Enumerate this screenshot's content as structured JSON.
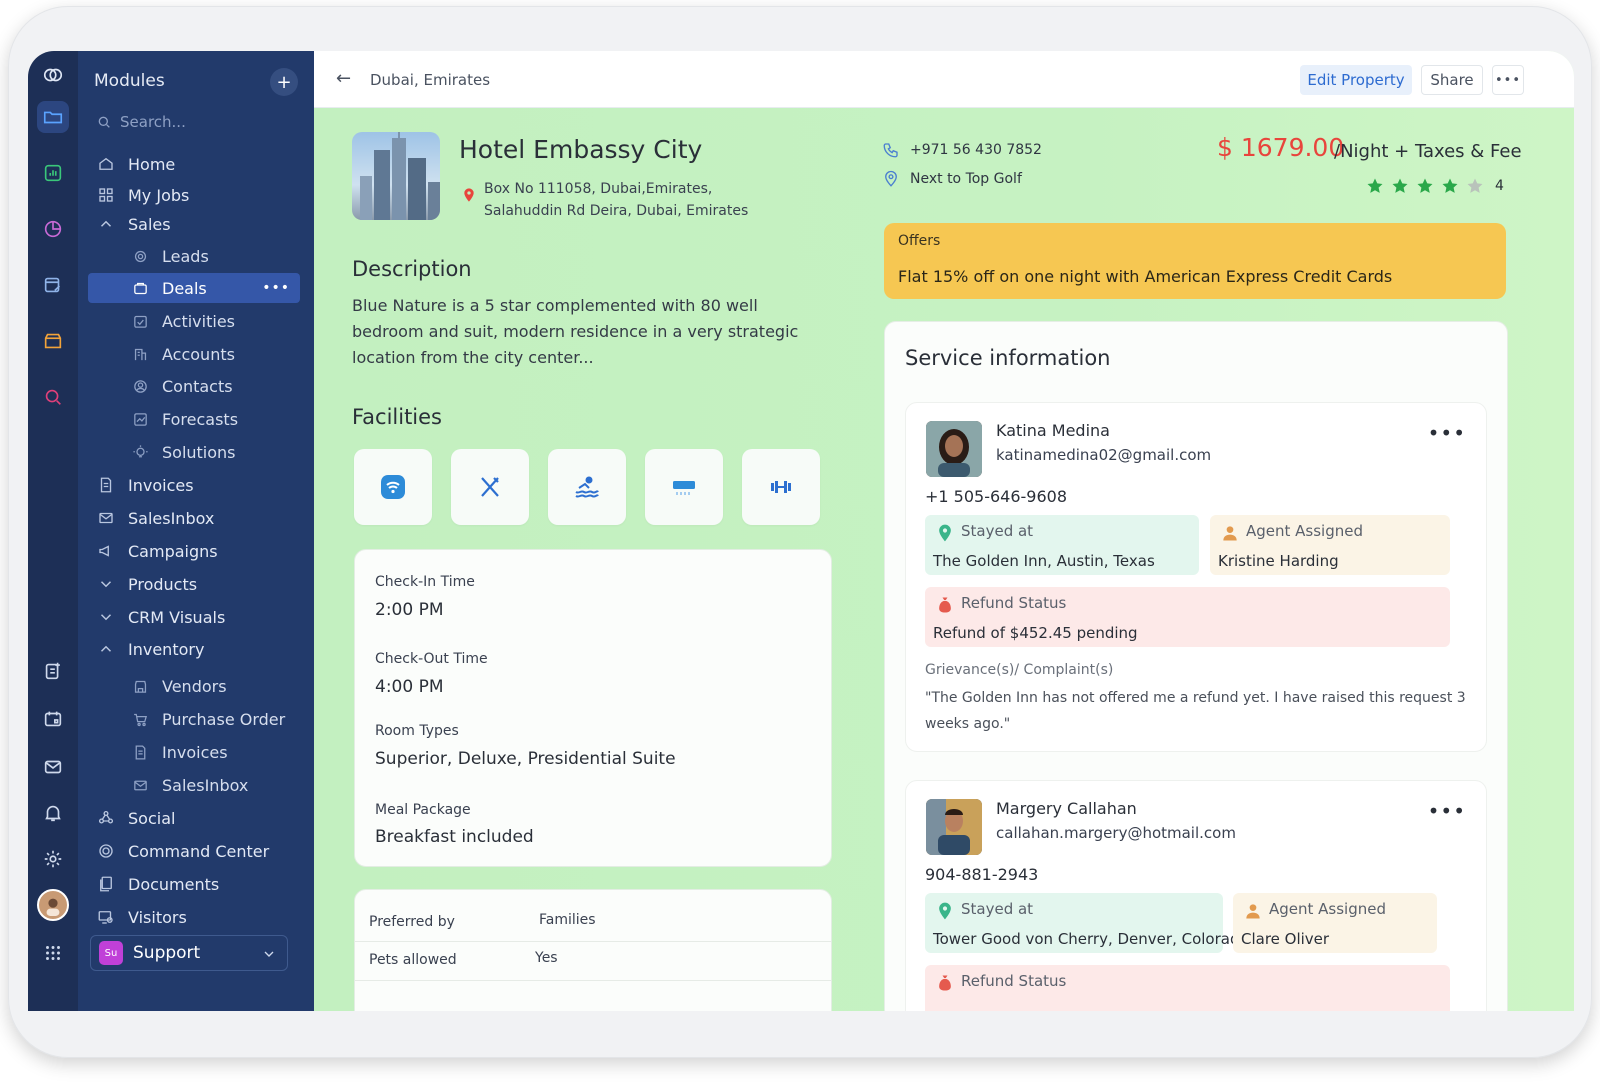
{
  "sidebar": {
    "title": "Modules",
    "search_placeholder": "Search...",
    "items": [
      {
        "label": "Home"
      },
      {
        "label": "My Jobs"
      },
      {
        "label": "Sales"
      },
      {
        "label": "Leads"
      },
      {
        "label": "Deals"
      },
      {
        "label": "Activities"
      },
      {
        "label": "Accounts"
      },
      {
        "label": "Contacts"
      },
      {
        "label": "Forecasts"
      },
      {
        "label": "Solutions"
      },
      {
        "label": "Invoices"
      },
      {
        "label": "SalesInbox"
      },
      {
        "label": "Campaigns"
      },
      {
        "label": "Products"
      },
      {
        "label": "CRM Visuals"
      },
      {
        "label": "Inventory"
      },
      {
        "label": "Vendors"
      },
      {
        "label": "Purchase Order"
      },
      {
        "label": "Invoices"
      },
      {
        "label": "SalesInbox"
      },
      {
        "label": "Social"
      },
      {
        "label": "Command Center"
      },
      {
        "label": "Documents"
      },
      {
        "label": "Visitors"
      }
    ],
    "support": {
      "badge": "Su",
      "label": "Support"
    }
  },
  "topbar": {
    "breadcrumb": "Dubai, Emirates",
    "edit_label": "Edit Property",
    "share_label": "Share"
  },
  "hotel": {
    "name": "Hotel Embassy City",
    "address_line1": "Box No 111058, Dubai,Emirates,",
    "address_line2": "Salahuddin Rd Deira, Dubai, Emirates",
    "phone": "+971 56 430 7852",
    "landmark": "Next to Top Golf",
    "price": "$ 1679.00",
    "price_suffix": "/Night + Taxes & Fee",
    "rating": "4",
    "rating_value": 4,
    "rating_max": 5
  },
  "description": {
    "heading": "Description",
    "text": "Blue Nature is a 5 star complemented with 80 well bedroom and suit, modern residence in a very strategic location from the city center..."
  },
  "facilities": {
    "heading": "Facilities",
    "icons": [
      "wifi-icon",
      "restaurant-icon",
      "swimming-pool-icon",
      "air-conditioner-icon",
      "gym-icon"
    ]
  },
  "details": {
    "checkin_label": "Check-In Time",
    "checkin_value": "2:00 PM",
    "checkout_label": "Check-Out Time",
    "checkout_value": "4:00 PM",
    "room_label": "Room Types",
    "room_value": "Superior, Deluxe, Presidential Suite",
    "meal_label": "Meal Package",
    "meal_value": "Breakfast included"
  },
  "prefs": {
    "preferred_label": "Preferred by",
    "preferred_value": "Families",
    "pets_label": "Pets allowed",
    "pets_value": "Yes"
  },
  "offers": {
    "title": "Offers",
    "text": "Flat 15% off on one night with American Express Credit Cards"
  },
  "service": {
    "heading": "Service information",
    "stayed_label": "Stayed at",
    "agent_label": "Agent Assigned",
    "refund_label": "Refund Status",
    "grievance_label": "Grievance(s)/ Complaint(s)",
    "people": [
      {
        "name": "Katina Medina",
        "email": "katinamedina02@gmail.com",
        "phone": "+1 505-646-9608",
        "stayed": "The Golden Inn, Austin, Texas",
        "agent": "Kristine Harding",
        "refund": "Refund of $452.45 pending",
        "complaint": "\"The Golden Inn has not offered me a refund yet. I have raised this request 3 weeks ago.\""
      },
      {
        "name": "Margery Callahan",
        "email": "callahan.margery@hotmail.com",
        "phone": "904-881-2943",
        "stayed": "Tower Good von Cherry, Denver, Colorado",
        "agent": "Clare Oliver"
      }
    ]
  },
  "colors": {
    "rail": "#1d2f56",
    "sidebar": "#223a6b",
    "active": "#3557a8",
    "price": "#e8453c",
    "offers": "#f6c752",
    "star": "#2aa84a"
  }
}
